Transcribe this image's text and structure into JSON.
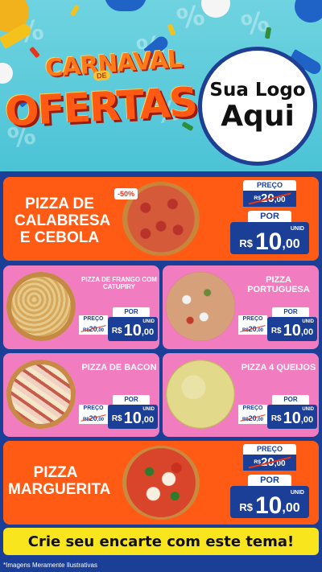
{
  "header": {
    "title_line1": "CARNAVAL",
    "title_small": "DE",
    "title_line2": "OFERTAS",
    "logo_line1": "Sua Logo",
    "logo_line2": "Aqui",
    "bg_symbol": "%"
  },
  "colors": {
    "navy": "#1b3f97",
    "orange_card": "#ff5b14",
    "pink_card": "#f27cc0",
    "cta_yellow": "#f8e51e",
    "header_teal": "#4cc3d6"
  },
  "labels": {
    "preco": "PREÇO",
    "por": "POR",
    "currency": "R$",
    "unid": "UNID"
  },
  "products": [
    {
      "name": "PIZZA DE CALABRESA E CEBOLA",
      "badge": "-50%",
      "old_int": "20",
      "old_dec": ",00",
      "new_int": "10",
      "new_dec": ",00",
      "image": "pizza-calabresa-image"
    },
    {
      "name": "PIZZA DE FRANGO COM CATUPIRY",
      "old_int": "20",
      "old_dec": ",00",
      "new_int": "10",
      "new_dec": ",00",
      "image": "pizza-frango-image"
    },
    {
      "name": "PIZZA PORTUGUESA",
      "old_int": "20",
      "old_dec": ",00",
      "new_int": "10",
      "new_dec": ",00",
      "image": "pizza-portuguesa-image"
    },
    {
      "name": "PIZZA DE BACON",
      "old_int": "20",
      "old_dec": ",00",
      "new_int": "10",
      "new_dec": ",00",
      "image": "pizza-bacon-image"
    },
    {
      "name": "PIZZA 4 QUEIJOS",
      "old_int": "20",
      "old_dec": ",00",
      "new_int": "10",
      "new_dec": ",00",
      "image": "pizza-4-queijos-image"
    },
    {
      "name": "PIZZA MARGUERITA",
      "old_int": "20",
      "old_dec": ",00",
      "new_int": "10",
      "new_dec": ",00",
      "image": "pizza-marguerita-image"
    }
  ],
  "cta": "Crie seu encarte com este tema!",
  "disclaimer": "*Imagens Meramente Ilustrativas"
}
